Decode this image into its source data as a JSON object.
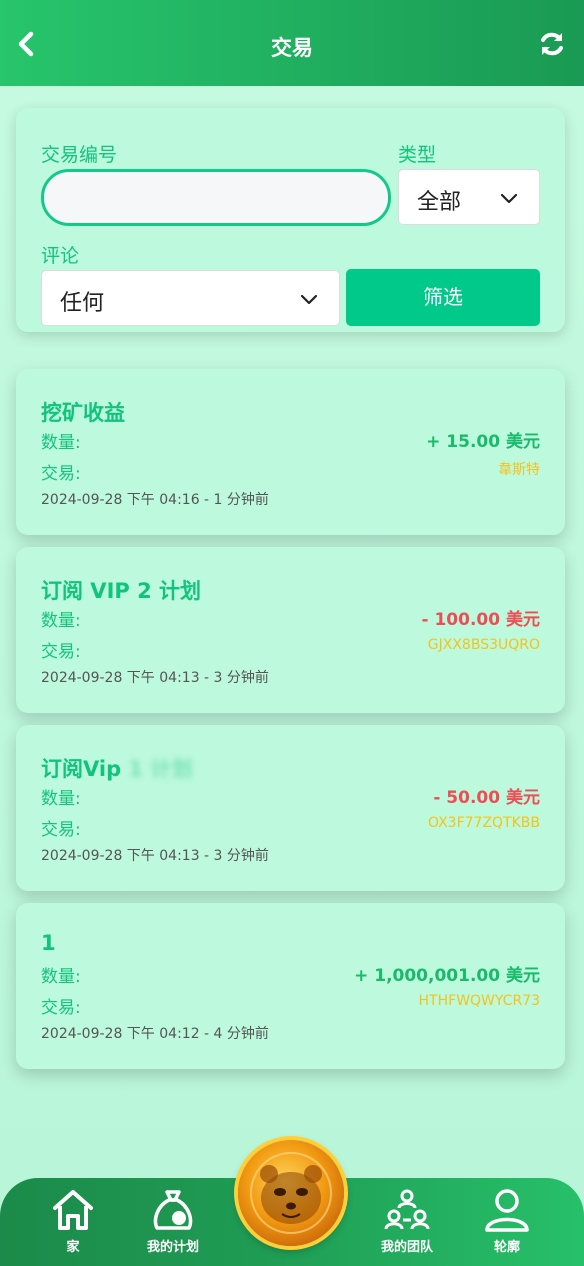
{
  "header": {
    "title": "交易",
    "back_icon": "chevron-left-icon",
    "refresh_icon": "refresh-icon"
  },
  "filter": {
    "tx_number_label": "交易编号",
    "tx_number_value": "",
    "type_label": "类型",
    "type_value": "全部",
    "comment_label": "评论",
    "comment_value": "任何",
    "filter_button": "筛选"
  },
  "labels": {
    "amount": "数量:",
    "transaction": "交易:"
  },
  "transactions": [
    {
      "title": "挖矿收益",
      "title_tail": "",
      "amount": "+ 15.00 美元",
      "sign": "pos",
      "tx_id": "韋斯特",
      "timestamp": "2024-09-28 下午 04:16 - 1 分钟前"
    },
    {
      "title": "订阅 VIP 2 计划",
      "title_tail": "",
      "amount": "- 100.00 美元",
      "sign": "neg",
      "tx_id": "GJXX8BS3UQRO",
      "timestamp": "2024-09-28 下午 04:13 - 3 分钟前"
    },
    {
      "title": "订阅Vip",
      "title_tail": "1 计划",
      "amount": "- 50.00 美元",
      "sign": "neg",
      "tx_id": "OX3F77ZQTKBB",
      "timestamp": "2024-09-28 下午 04:13 - 3 分钟前"
    },
    {
      "title": "1",
      "title_tail": "",
      "amount": "+ 1,000,001.00 美元",
      "sign": "pos",
      "tx_id": "HTHFWQWYCR73",
      "timestamp": "2024-09-28 下午 04:12 - 4 分钟前"
    }
  ],
  "nav": {
    "home": "家",
    "my_plan": "我的计划",
    "my_team": "我的团队",
    "profile": "轮廓",
    "center_icon": "hamster-coin-icon"
  },
  "colors": {
    "accent": "#12c47c",
    "positive": "#19ba6b",
    "negative": "#ef4d55",
    "tx_id": "#f6c21a",
    "header": "#1f9c54"
  }
}
